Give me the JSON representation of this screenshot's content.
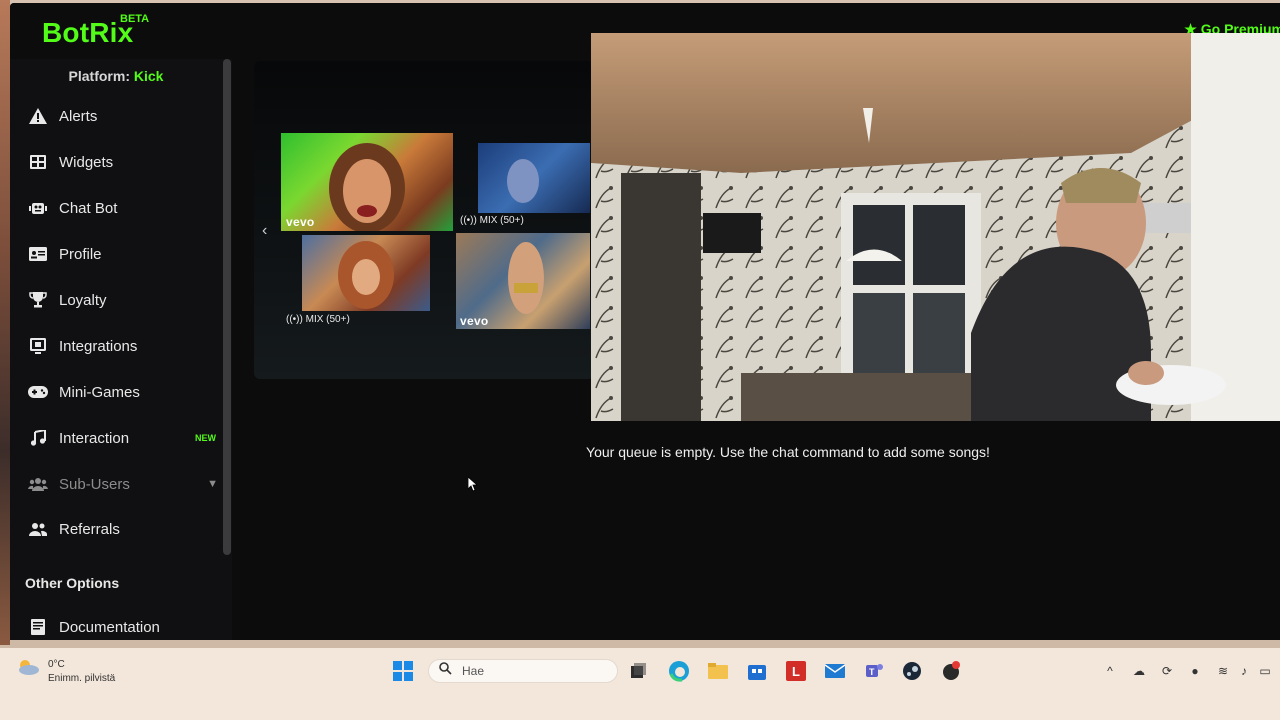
{
  "app": {
    "logo": "BotRix",
    "beta": "BETA",
    "premium_label": "Go Premium"
  },
  "sidebar": {
    "platform_prefix": "Platform:",
    "platform_name": "Kick",
    "items": [
      {
        "label": "Alerts",
        "icon": "warning-icon"
      },
      {
        "label": "Widgets",
        "icon": "widgets-icon"
      },
      {
        "label": "Chat Bot",
        "icon": "robot-icon"
      },
      {
        "label": "Profile",
        "icon": "id-card-icon"
      },
      {
        "label": "Loyalty",
        "icon": "trophy-icon"
      },
      {
        "label": "Integrations",
        "icon": "integrations-icon"
      },
      {
        "label": "Mini-Games",
        "icon": "gamepad-icon"
      },
      {
        "label": "Interaction",
        "icon": "music-note-icon",
        "badge": "NEW"
      },
      {
        "label": "Sub-Users",
        "icon": "users-icon"
      },
      {
        "label": "Referrals",
        "icon": "referrals-icon"
      }
    ],
    "other_options_title": "Other Options",
    "documentation_label": "Documentation"
  },
  "player": {
    "mix_label_1": "MIX (50+)",
    "mix_label_2": "MIX (50+)",
    "vevo_1": "vevo",
    "vevo_2": "vevo"
  },
  "queue": {
    "empty_message": "Your queue is empty. Use the chat command to add some songs!"
  },
  "taskbar": {
    "weather_temp": "0°C",
    "weather_desc": "Enimm. pilvistä",
    "search_placeholder": "Hae",
    "icons": [
      "windows-start-icon",
      "search-icon",
      "task-view-icon",
      "edge-icon",
      "file-explorer-icon",
      "store-icon",
      "lastpass-icon",
      "mail-icon",
      "teams-icon",
      "steam-icon",
      "app-icon"
    ]
  },
  "colors": {
    "accent": "#53fc18",
    "background": "#0c0c0d",
    "sidebar": "#101012"
  }
}
